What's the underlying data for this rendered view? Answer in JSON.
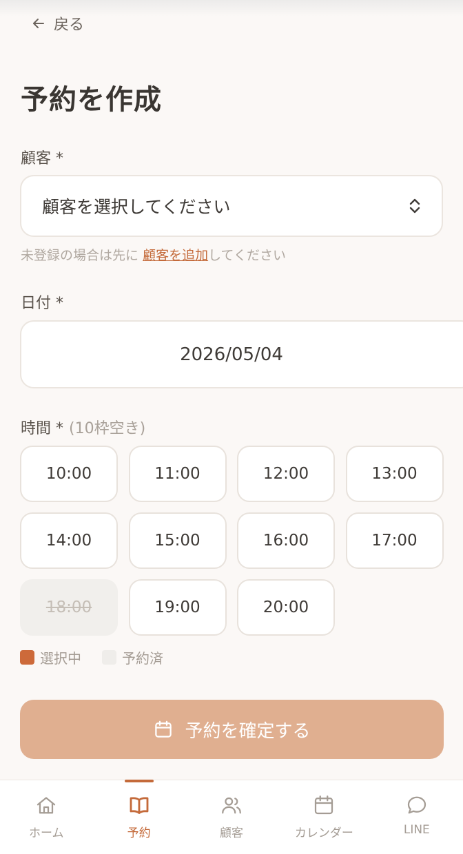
{
  "header": {
    "back_label": "戻る"
  },
  "page_title": "予約を作成",
  "customer": {
    "label": "顧客 *",
    "select_value": "顧客を選択してください",
    "helper_prefix": "未登録の場合は先に",
    "helper_link": "顧客を追加",
    "helper_suffix": "してください"
  },
  "date": {
    "label": "日付 *",
    "value": "2026/05/04"
  },
  "time": {
    "label": "時間 *",
    "availability": "(10枠空き)",
    "slots": [
      {
        "time": "10:00",
        "status": "available"
      },
      {
        "time": "11:00",
        "status": "available"
      },
      {
        "time": "12:00",
        "status": "available"
      },
      {
        "time": "13:00",
        "status": "available"
      },
      {
        "time": "14:00",
        "status": "available"
      },
      {
        "time": "15:00",
        "status": "available"
      },
      {
        "time": "16:00",
        "status": "available"
      },
      {
        "time": "17:00",
        "status": "available"
      },
      {
        "time": "18:00",
        "status": "booked"
      },
      {
        "time": "19:00",
        "status": "available"
      },
      {
        "time": "20:00",
        "status": "available"
      }
    ]
  },
  "legend": {
    "selected": "選択中",
    "booked": "予約済"
  },
  "submit_label": "予約を確定する",
  "nav": {
    "items": [
      {
        "label": "ホーム",
        "icon": "home-icon"
      },
      {
        "label": "予約",
        "icon": "book-icon"
      },
      {
        "label": "顧客",
        "icon": "users-icon"
      },
      {
        "label": "カレンダー",
        "icon": "calendar-icon"
      },
      {
        "label": "LINE",
        "icon": "chat-icon"
      }
    ],
    "active": "予約"
  },
  "colors": {
    "accent": "#c46a3a",
    "button": "#e0af90",
    "background": "#fbf8f6",
    "booked": "#f1efec"
  }
}
